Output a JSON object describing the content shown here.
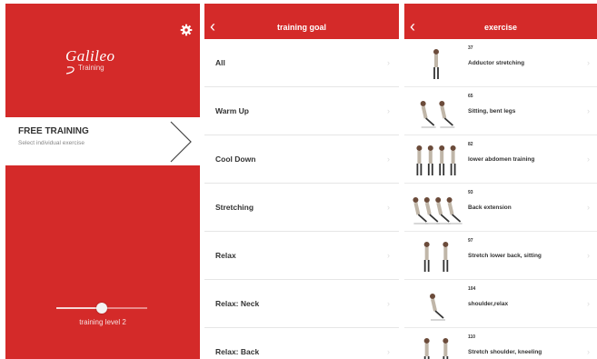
{
  "home": {
    "logo_name": "Galileo",
    "logo_sub": "Training",
    "free_title": "FREE TRAINING",
    "free_subtitle": "Select individual exercise",
    "level_label": "training level 2",
    "level_fraction": 0.5
  },
  "goals": {
    "title": "training goal",
    "items": [
      "All",
      "Warm Up",
      "Cool Down",
      "Stretching",
      "Relax",
      "Relax: Neck",
      "Relax: Back"
    ]
  },
  "exercise": {
    "title": "exercise",
    "items": [
      {
        "num": "37",
        "name": "Adductor stretching"
      },
      {
        "num": "65",
        "name": "Sitting, bent legs"
      },
      {
        "num": "82",
        "name": "lower abdomen training"
      },
      {
        "num": "93",
        "name": "Back extension"
      },
      {
        "num": "97",
        "name": "Stretch lower back, sitting"
      },
      {
        "num": "104",
        "name": "shoulder,relax"
      },
      {
        "num": "110",
        "name": "Stretch shoulder, kneeling"
      }
    ]
  },
  "colors": {
    "brand_red": "#d42a29"
  }
}
